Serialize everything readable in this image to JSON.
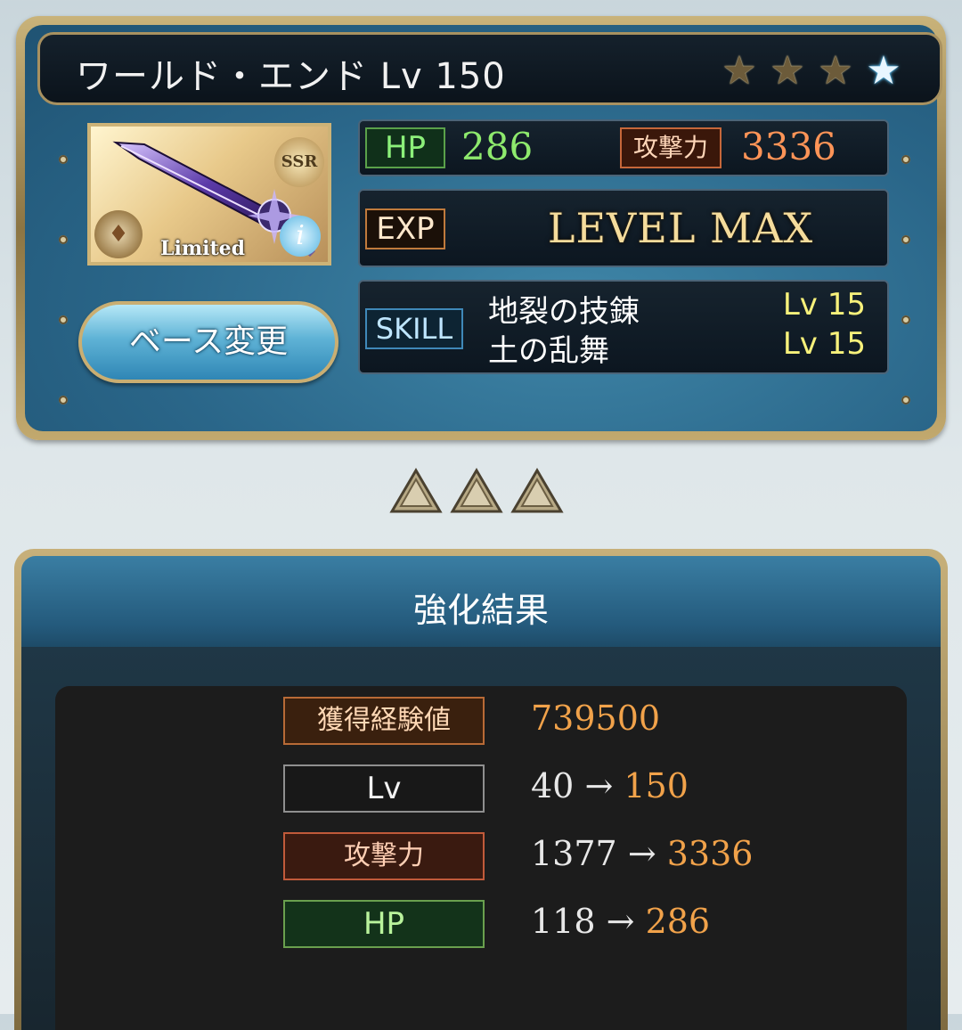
{
  "weapon": {
    "title": "ワールド・エンド Lv 150",
    "rarity": "SSR",
    "limited_label": "Limited",
    "stars": [
      "gold",
      "gold",
      "gold",
      "blue"
    ],
    "hp_label": "HP",
    "hp_value": "286",
    "atk_label": "攻撃力",
    "atk_value": "3336",
    "exp_label": "EXP",
    "exp_status": "LEVEL MAX",
    "skill_label": "SKILL",
    "skills": [
      {
        "name": "地裂の技錬",
        "level": "Lv 15"
      },
      {
        "name": "土の乱舞",
        "level": "Lv 15"
      }
    ],
    "base_change_button": "ベース変更"
  },
  "uncap_indicator": {
    "count": 3
  },
  "result": {
    "title": "強化結果",
    "rows": [
      {
        "label": "獲得経験値",
        "before": "",
        "arrow": "",
        "after": "739500"
      },
      {
        "label": "Lv",
        "before": "40",
        "arrow": "→",
        "after": "150"
      },
      {
        "label": "攻撃力",
        "before": "1377",
        "arrow": "→",
        "after": "3336"
      },
      {
        "label": "HP",
        "before": "118",
        "arrow": "→",
        "after": "286"
      }
    ]
  },
  "colors": {
    "hp_green": "#8eea6d",
    "atk_orange": "#ff9457",
    "skill_lv_yellow": "#f7f17b",
    "result_value_orange": "#f1a24a"
  }
}
